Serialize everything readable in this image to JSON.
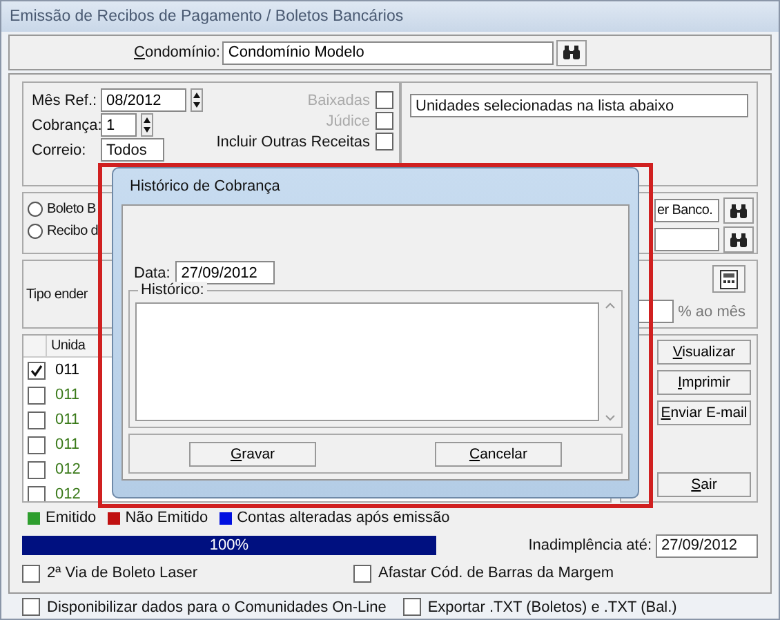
{
  "window": {
    "title": "Emissão de Recibos de Pagamento / Boletos Bancários"
  },
  "condominio": {
    "label": "Condomínio:",
    "value": "Condomínio Modelo"
  },
  "filters": {
    "mes_ref": {
      "label": "Mês Ref.:",
      "value": "08/2012"
    },
    "cobranca": {
      "label": "Cobrança:",
      "value": "1"
    },
    "correio": {
      "label": "Correio:",
      "value": "Todos"
    },
    "options": [
      {
        "label": "Baixadas",
        "checked": false,
        "disabled": true
      },
      {
        "label": "Júdice",
        "checked": false,
        "disabled": true
      },
      {
        "label": "Incluir Outras Receitas",
        "checked": false,
        "disabled": false
      }
    ],
    "units_select": "Unidades selecionadas na lista abaixo"
  },
  "print_type": {
    "radios": [
      {
        "label": "Boleto B",
        "selected": false
      },
      {
        "label": "Recibo d",
        "selected": false
      }
    ],
    "bank_field": "er Banco."
  },
  "address": {
    "label": "Tipo ender",
    "rate_suffix": "% ao mês"
  },
  "grid": {
    "columns": [
      "Unida"
    ],
    "rows": [
      {
        "unit": "011",
        "checked": true,
        "color": "#000000"
      },
      {
        "unit": "011",
        "checked": false,
        "color": "#3a7a1a"
      },
      {
        "unit": "011",
        "checked": false,
        "color": "#3a7a1a"
      },
      {
        "unit": "011",
        "checked": false,
        "color": "#3a7a1a"
      },
      {
        "unit": "012",
        "checked": false,
        "color": "#3a7a1a"
      },
      {
        "unit": "012",
        "checked": false,
        "color": "#3a7a1a"
      }
    ]
  },
  "actions": [
    "Visualizar",
    "Imprimir",
    "Enviar E-mail",
    "Sair"
  ],
  "legend": [
    {
      "label": "Emitido",
      "color": "#2e9e2e"
    },
    {
      "label": "Não Emitido",
      "color": "#c01010"
    },
    {
      "label": "Contas alteradas após emissão",
      "color": "#0010e0"
    }
  ],
  "progress": {
    "level": 1,
    "text": "100%"
  },
  "inadimplencia": {
    "label": "Inadimplência até:",
    "value": "27/09/2012"
  },
  "options": [
    {
      "label": "2ª Via de Boleto Laser",
      "checked": false
    },
    {
      "label": "Afastar Cód. de Barras da Margem",
      "checked": false
    }
  ],
  "footer_options": [
    {
      "label": "Disponibilizar dados para o Comunidades On-Line",
      "checked": false
    },
    {
      "label": "Exportar .TXT (Boletos) e .TXT (Bal.)",
      "checked": false
    }
  ],
  "dialog": {
    "title": "Histórico de Cobrança",
    "date_label": "Data:",
    "date": "27/09/2012",
    "history_label": "Histórico:",
    "buttons": [
      "Gravar",
      "Cancelar"
    ]
  }
}
